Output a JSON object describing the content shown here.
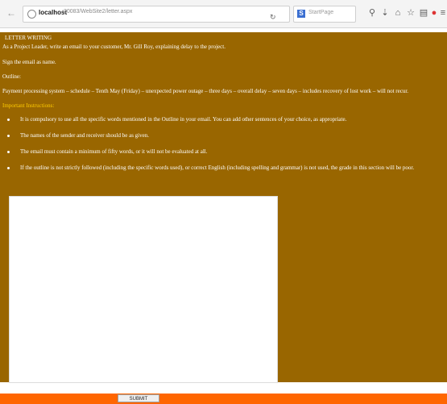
{
  "browser": {
    "url_host": "localhost",
    "url_path": ":30083/WebSite2/letter.aspx",
    "search_placeholder": "StartPage",
    "search_engine_glyph": "S"
  },
  "page": {
    "heading": "LETTER WRITING",
    "task": "As a Project Leader, write an email to your customer, Mr. Gill Roy, explaining delay to the project.",
    "sign": "Sign the email as name.",
    "outline_label": "Outline:",
    "outline": "Payment processing system – schedule – Tenth May (Friday) – unexpected power outage – three days – overall delay – seven days – includes recovery of lost work – will not recur.",
    "instructions_label": "Important Instructions:",
    "instructions": [
      "It is compulsory to use all the specific words mentioned in the Outline in your email. You can add other sentences of your choice, as appropriate.",
      "The names of the sender and receiver should be as given.",
      "The email must contain a minimum of fifty words, or it will not be evaluated at all.",
      "If the outline is not strictly followed (including the specific words used), or correct English (including spelling and grammar) is not used, the grade in this section will be poor."
    ],
    "email_value": ""
  },
  "footer": {
    "submit_label": "SUBMIT"
  },
  "colors": {
    "background": "#996600",
    "instructions_label": "#ffcc00",
    "submit_bar": "#ff6600"
  }
}
